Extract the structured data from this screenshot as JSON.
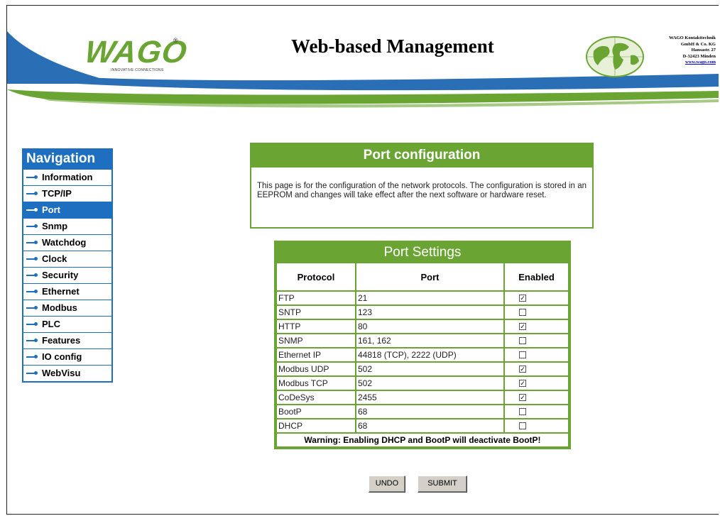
{
  "header": {
    "title": "Web-based Management",
    "logo_text": "WAGO",
    "logo_tagline": "INNOVATIVE CONNECTIONS",
    "address": [
      "WAGO Kontakttechnik",
      "GmbH & Co. KG",
      "Hansastr. 27",
      "D-32423 Minden",
      "www.wago.com"
    ]
  },
  "navigation": {
    "title": "Navigation",
    "items": [
      {
        "label": "Information"
      },
      {
        "label": "TCP/IP"
      },
      {
        "label": "Port"
      },
      {
        "label": "Snmp"
      },
      {
        "label": "Watchdog"
      },
      {
        "label": "Clock"
      },
      {
        "label": "Security"
      },
      {
        "label": "Ethernet"
      },
      {
        "label": "Modbus"
      },
      {
        "label": "PLC"
      },
      {
        "label": "Features"
      },
      {
        "label": "IO config"
      },
      {
        "label": "WebVisu"
      }
    ],
    "active": "Port"
  },
  "info": {
    "title": "Port configuration",
    "text": "This page is for the configuration of the network protocols. The configuration is stored in an EEPROM and changes will take effect after the next software or hardware reset."
  },
  "settings": {
    "title": "Port Settings",
    "columns": [
      "Protocol",
      "Port",
      "Enabled"
    ],
    "rows": [
      {
        "protocol": "FTP",
        "port": "21",
        "enabled": true
      },
      {
        "protocol": "SNTP",
        "port": "123",
        "enabled": false
      },
      {
        "protocol": "HTTP",
        "port": "80",
        "enabled": true
      },
      {
        "protocol": "SNMP",
        "port": "161, 162",
        "enabled": false
      },
      {
        "protocol": "Ethernet IP",
        "port": "44818 (TCP), 2222 (UDP)",
        "enabled": false
      },
      {
        "protocol": "Modbus UDP",
        "port": "502",
        "enabled": true
      },
      {
        "protocol": "Modbus TCP",
        "port": "502",
        "enabled": true
      },
      {
        "protocol": "CoDeSys",
        "port": "2455",
        "enabled": true
      },
      {
        "protocol": "BootP",
        "port": "68",
        "enabled": false
      },
      {
        "protocol": "DHCP",
        "port": "68",
        "enabled": false
      }
    ],
    "warning": "Warning: Enabling DHCP and BootP will deactivate BootP!"
  },
  "buttons": {
    "undo": "UNDO",
    "submit": "SUBMIT"
  },
  "colors": {
    "brand_green": "#6aa534",
    "nav_blue": "#1f6fc1",
    "swoosh_blue": "#2a6fb5"
  }
}
